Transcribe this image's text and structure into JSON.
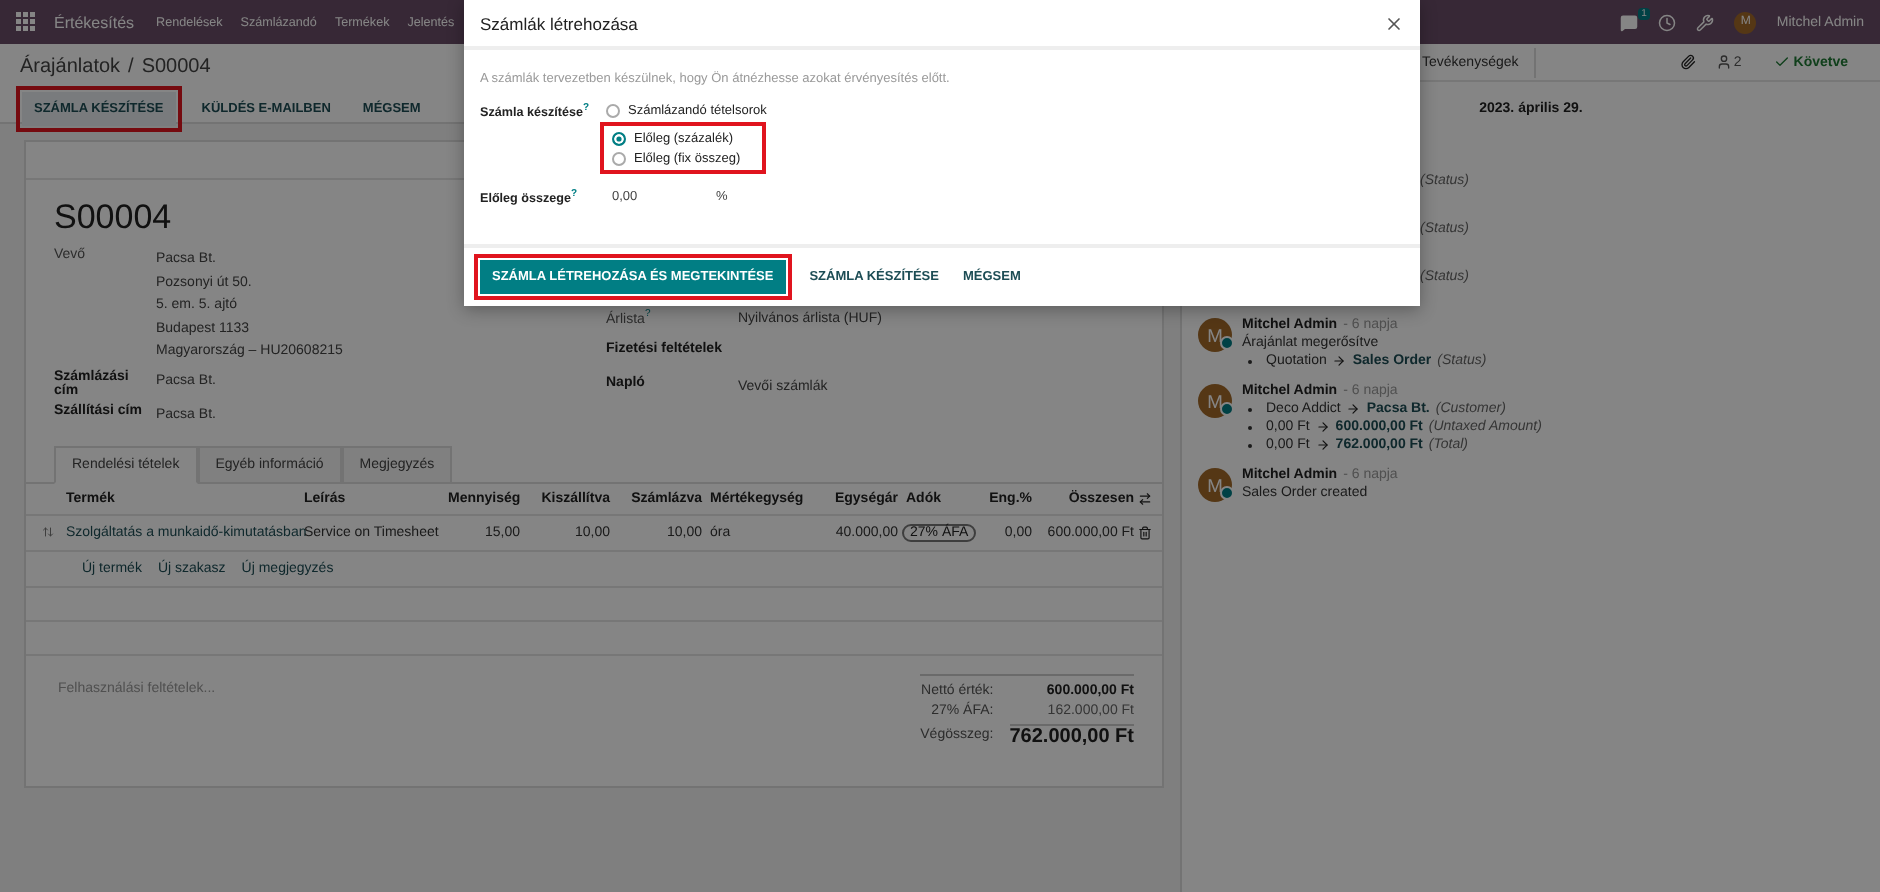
{
  "navbar": {
    "app": "Értékesítés",
    "menu": [
      "Rendelések",
      "Számlázandó",
      "Termékek",
      "Jelentés"
    ],
    "chat_badge": "1",
    "user_initial": "M",
    "user": "Mitchel Admin"
  },
  "breadcrumb": {
    "parent": "Árajánlatok",
    "separator": "/",
    "current": "S00004"
  },
  "actions": [
    {
      "label": "SZÁMLA KÉSZÍTÉSE",
      "highlighted": true
    },
    {
      "label": "KÜLDÉS E-MAILBEN",
      "highlighted": false
    },
    {
      "label": "MÉGSEM",
      "highlighted": false
    }
  ],
  "order": {
    "name": "S00004",
    "customer_fields": [
      {
        "label": "Vevő",
        "lines": [
          "Pacsa Bt.",
          "Pozsonyi út 50.",
          "5. em. 5. ajtó",
          "Budapest 1133",
          "Magyarország – HU20608215"
        ]
      },
      {
        "label": "Számlázási cím",
        "lines": [
          "Pacsa Bt."
        ]
      },
      {
        "label": "Szállítási cím",
        "lines": [
          "Pacsa Bt."
        ]
      }
    ],
    "info_fields": [
      {
        "label": "Árlista",
        "help": "?",
        "value": "Nyilvános árlista (HUF)"
      },
      {
        "label": "Fizetési feltételek"
      },
      {
        "label": "Napló",
        "value": "Vevői számlák"
      }
    ],
    "tabs": [
      {
        "label": "Rendelési tételek",
        "selected": true
      },
      {
        "label": "Egyéb információ",
        "selected": false
      },
      {
        "label": "Megjegyzés",
        "selected": false
      }
    ],
    "table": {
      "columns": [
        "Termék",
        "Leírás",
        "Mennyiség",
        "Kiszállítva",
        "Számlázva",
        "Mértékegység",
        "Egységár",
        "Adók",
        "Eng.%",
        "Összesen"
      ],
      "rows": [
        {
          "product": "Szolgáltatás a munkaidő-kimutatásban",
          "description": "Service on Timesheet",
          "quantity": "15,00",
          "delivered": "10,00",
          "invoiced": "10,00",
          "uom": "óra",
          "unit_price": "40.000,00",
          "tax": "27% ÁFA",
          "discount": "0,00",
          "subtotal": "600.000,00 Ft"
        }
      ],
      "add_links": [
        "Új termék",
        "Új szakasz",
        "Új megjegyzés"
      ]
    },
    "terms_placeholder": "Felhasználási feltételek...",
    "totals": [
      {
        "kind": "subtotal",
        "label": "Nettó érték:",
        "value": "600.000,00 Ft"
      },
      {
        "kind": "tax",
        "label": "27% ÁFA:",
        "value": "162.000,00 Ft"
      },
      {
        "kind": "total",
        "label": "Végösszeg:",
        "value": "762.000,00 Ft"
      }
    ]
  },
  "chatter": {
    "activities_button": "Tevékenységek",
    "followers": "2",
    "follow_label": "Követve",
    "date": "2023. április 29.",
    "messages": [
      {
        "kind": "partial",
        "tag": "(Status)"
      },
      {
        "kind": "partial",
        "tag": "(Status)"
      },
      {
        "kind": "partial",
        "tag": "(Status)"
      },
      {
        "kind": "full",
        "avatar": "M",
        "author": "Mitchel Admin",
        "time": "- 6 napja",
        "body": "Árajánlat megerősítve",
        "changes": [
          {
            "old": "Quotation",
            "new": "Sales Order",
            "field": "(Status)"
          }
        ]
      },
      {
        "kind": "full",
        "avatar": "M",
        "author": "Mitchel Admin",
        "time": "- 6 napja",
        "changes": [
          {
            "old": "Deco Addict",
            "new": "Pacsa Bt.",
            "field": "(Customer)"
          },
          {
            "old": "0,00 Ft",
            "new": "600.000,00 Ft",
            "field": "(Untaxed Amount)"
          },
          {
            "old": "0,00 Ft",
            "new": "762.000,00 Ft",
            "field": "(Total)"
          }
        ]
      },
      {
        "kind": "full",
        "avatar": "M",
        "author": "Mitchel Admin",
        "time": "- 6 napja",
        "body": "Sales Order created"
      }
    ]
  },
  "dialog": {
    "title": "Számlák létrehozása",
    "note": "A számlák tervezetben készülnek, hogy Ön átnézhesse azokat érvényesítés előtt.",
    "method_label": "Számla készítése",
    "method_help": "?",
    "options": [
      {
        "label": "Számlázandó tételsorok",
        "selected": false,
        "highlighted": false
      },
      {
        "label": "Előleg (százalék)",
        "selected": true,
        "highlighted": true
      },
      {
        "label": "Előleg (fix összeg)",
        "selected": false,
        "highlighted": true
      }
    ],
    "amount_label": "Előleg összege",
    "amount_help": "?",
    "amount": "0,00",
    "amount_unit": "%",
    "buttons": [
      {
        "label": "SZÁMLA LÉTREHOZÁSA ÉS MEGTEKINTÉSE",
        "kind": "primary",
        "highlighted": true
      },
      {
        "label": "SZÁMLA KÉSZÍTÉSE",
        "kind": "link",
        "highlighted": false
      },
      {
        "label": "MÉGSEM",
        "kind": "link",
        "highlighted": false
      }
    ]
  }
}
